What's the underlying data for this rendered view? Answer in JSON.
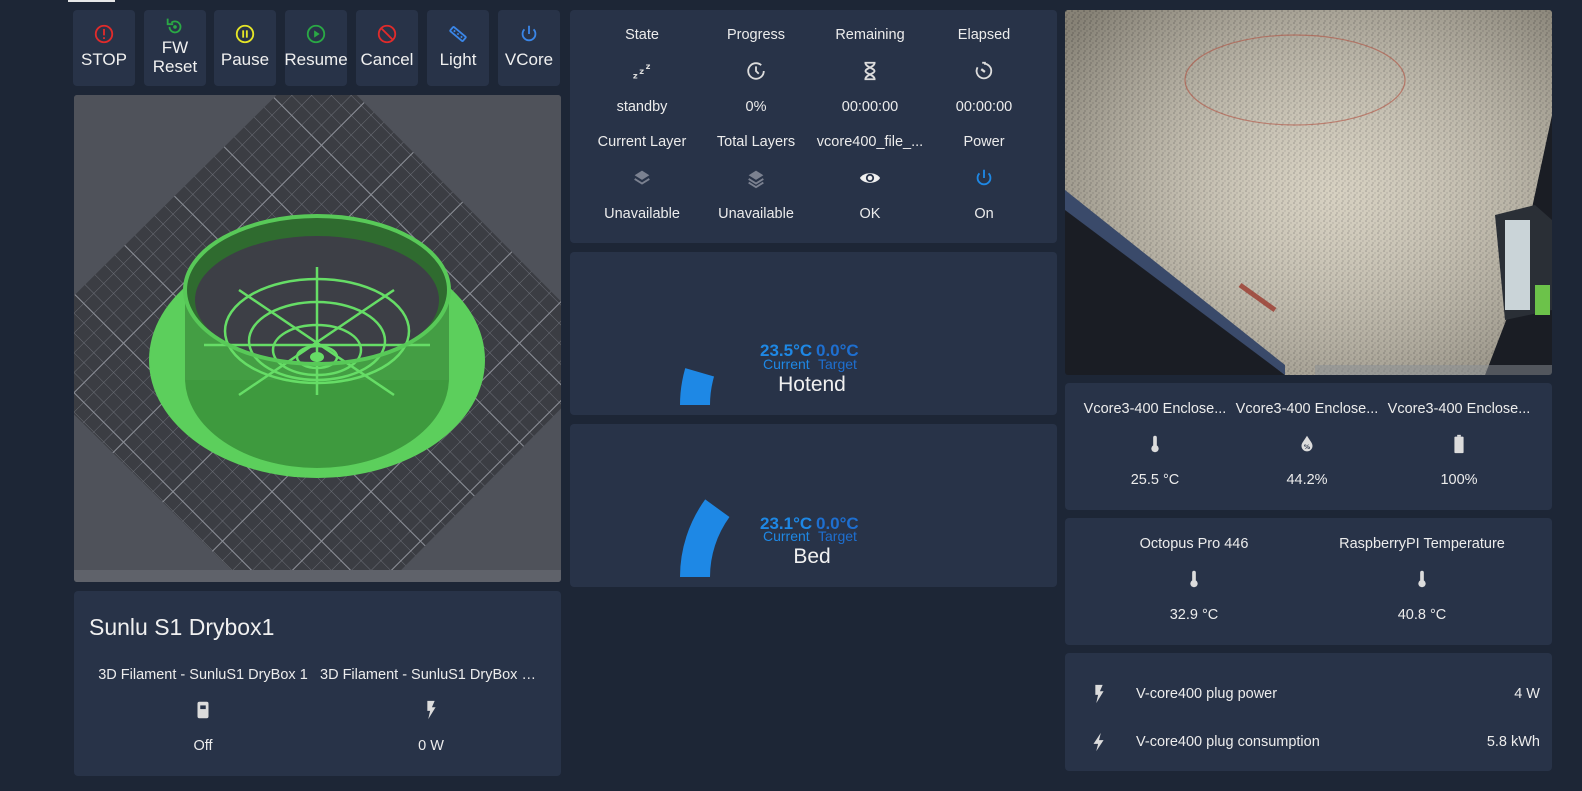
{
  "buttons": [
    {
      "label": "STOP",
      "icon": "stop-icon",
      "color": "#e02b2b"
    },
    {
      "label": "FW Reset",
      "icon": "restart-icon",
      "color": "#2aa845"
    },
    {
      "label": "Pause",
      "icon": "pause-icon",
      "color": "#e6e627"
    },
    {
      "label": "Resume",
      "icon": "play-icon",
      "color": "#2aa845"
    },
    {
      "label": "Cancel",
      "icon": "cancel-icon",
      "color": "#e02b2b"
    },
    {
      "label": "Light",
      "icon": "led-strip-icon",
      "color": "#3a86e8"
    },
    {
      "label": "VCore",
      "icon": "power-icon",
      "color": "#3a86e8"
    }
  ],
  "status": {
    "row1": [
      {
        "name": "State",
        "value": "standby",
        "icon": "sleep-icon"
      },
      {
        "name": "Progress",
        "value": "0%",
        "icon": "clock-icon"
      },
      {
        "name": "Remaining",
        "value": "00:00:00",
        "icon": "hourglass-icon"
      },
      {
        "name": "Elapsed",
        "value": "00:00:00",
        "icon": "timer-icon"
      }
    ],
    "row2": [
      {
        "name": "Current Layer",
        "value": "Unavailable",
        "icon": "layers-icon"
      },
      {
        "name": "Total Layers",
        "value": "Unavailable",
        "icon": "layers-icon"
      },
      {
        "name": "vcore400_file_...",
        "value": "OK",
        "icon": "eye-icon"
      },
      {
        "name": "Power",
        "value": "On",
        "icon": "power-icon"
      }
    ]
  },
  "hotend": {
    "current": "23.5°C",
    "target": "0.0°C",
    "current_label": "Current",
    "target_label": "Target",
    "name": "Hotend",
    "gauge_fraction": 0.09
  },
  "bed": {
    "current": "23.1°C",
    "target": "0.0°C",
    "current_label": "Current",
    "target_label": "Target",
    "name": "Bed",
    "gauge_fraction": 0.2
  },
  "enclosure": [
    {
      "name": "Vcore3-400 Enclose...",
      "value": "25.5 °C",
      "icon": "thermometer-icon"
    },
    {
      "name": "Vcore3-400 Enclose...",
      "value": "44.2%",
      "icon": "humidity-icon"
    },
    {
      "name": "Vcore3-400 Enclose...",
      "value": "100%",
      "icon": "battery-icon"
    }
  ],
  "boards": [
    {
      "name": "Octopus Pro 446",
      "value": "32.9 °C",
      "icon": "thermometer-icon"
    },
    {
      "name": "RaspberryPI Temperature",
      "value": "40.8 °C",
      "icon": "thermometer-icon"
    }
  ],
  "plug": [
    {
      "name": "V-core400 plug power",
      "value": "4 W",
      "icon": "flash-icon"
    },
    {
      "name": "V-core400 plug consumption",
      "value": "5.8 kWh",
      "icon": "lightning-icon"
    }
  ],
  "drybox": {
    "title": "Sunlu S1 Drybox1",
    "items": [
      {
        "name": "3D Filament - SunluS1 DryBox 1",
        "value": "Off",
        "icon": "plug-icon"
      },
      {
        "name": "3D Filament - SunluS1 DryBox 1 ...",
        "value": "0 W",
        "icon": "flash-icon"
      }
    ]
  },
  "colors": {
    "accent": "#1e88e5",
    "card": "#283348",
    "background": "#1d2636",
    "print_green": "#5ccf5c"
  }
}
